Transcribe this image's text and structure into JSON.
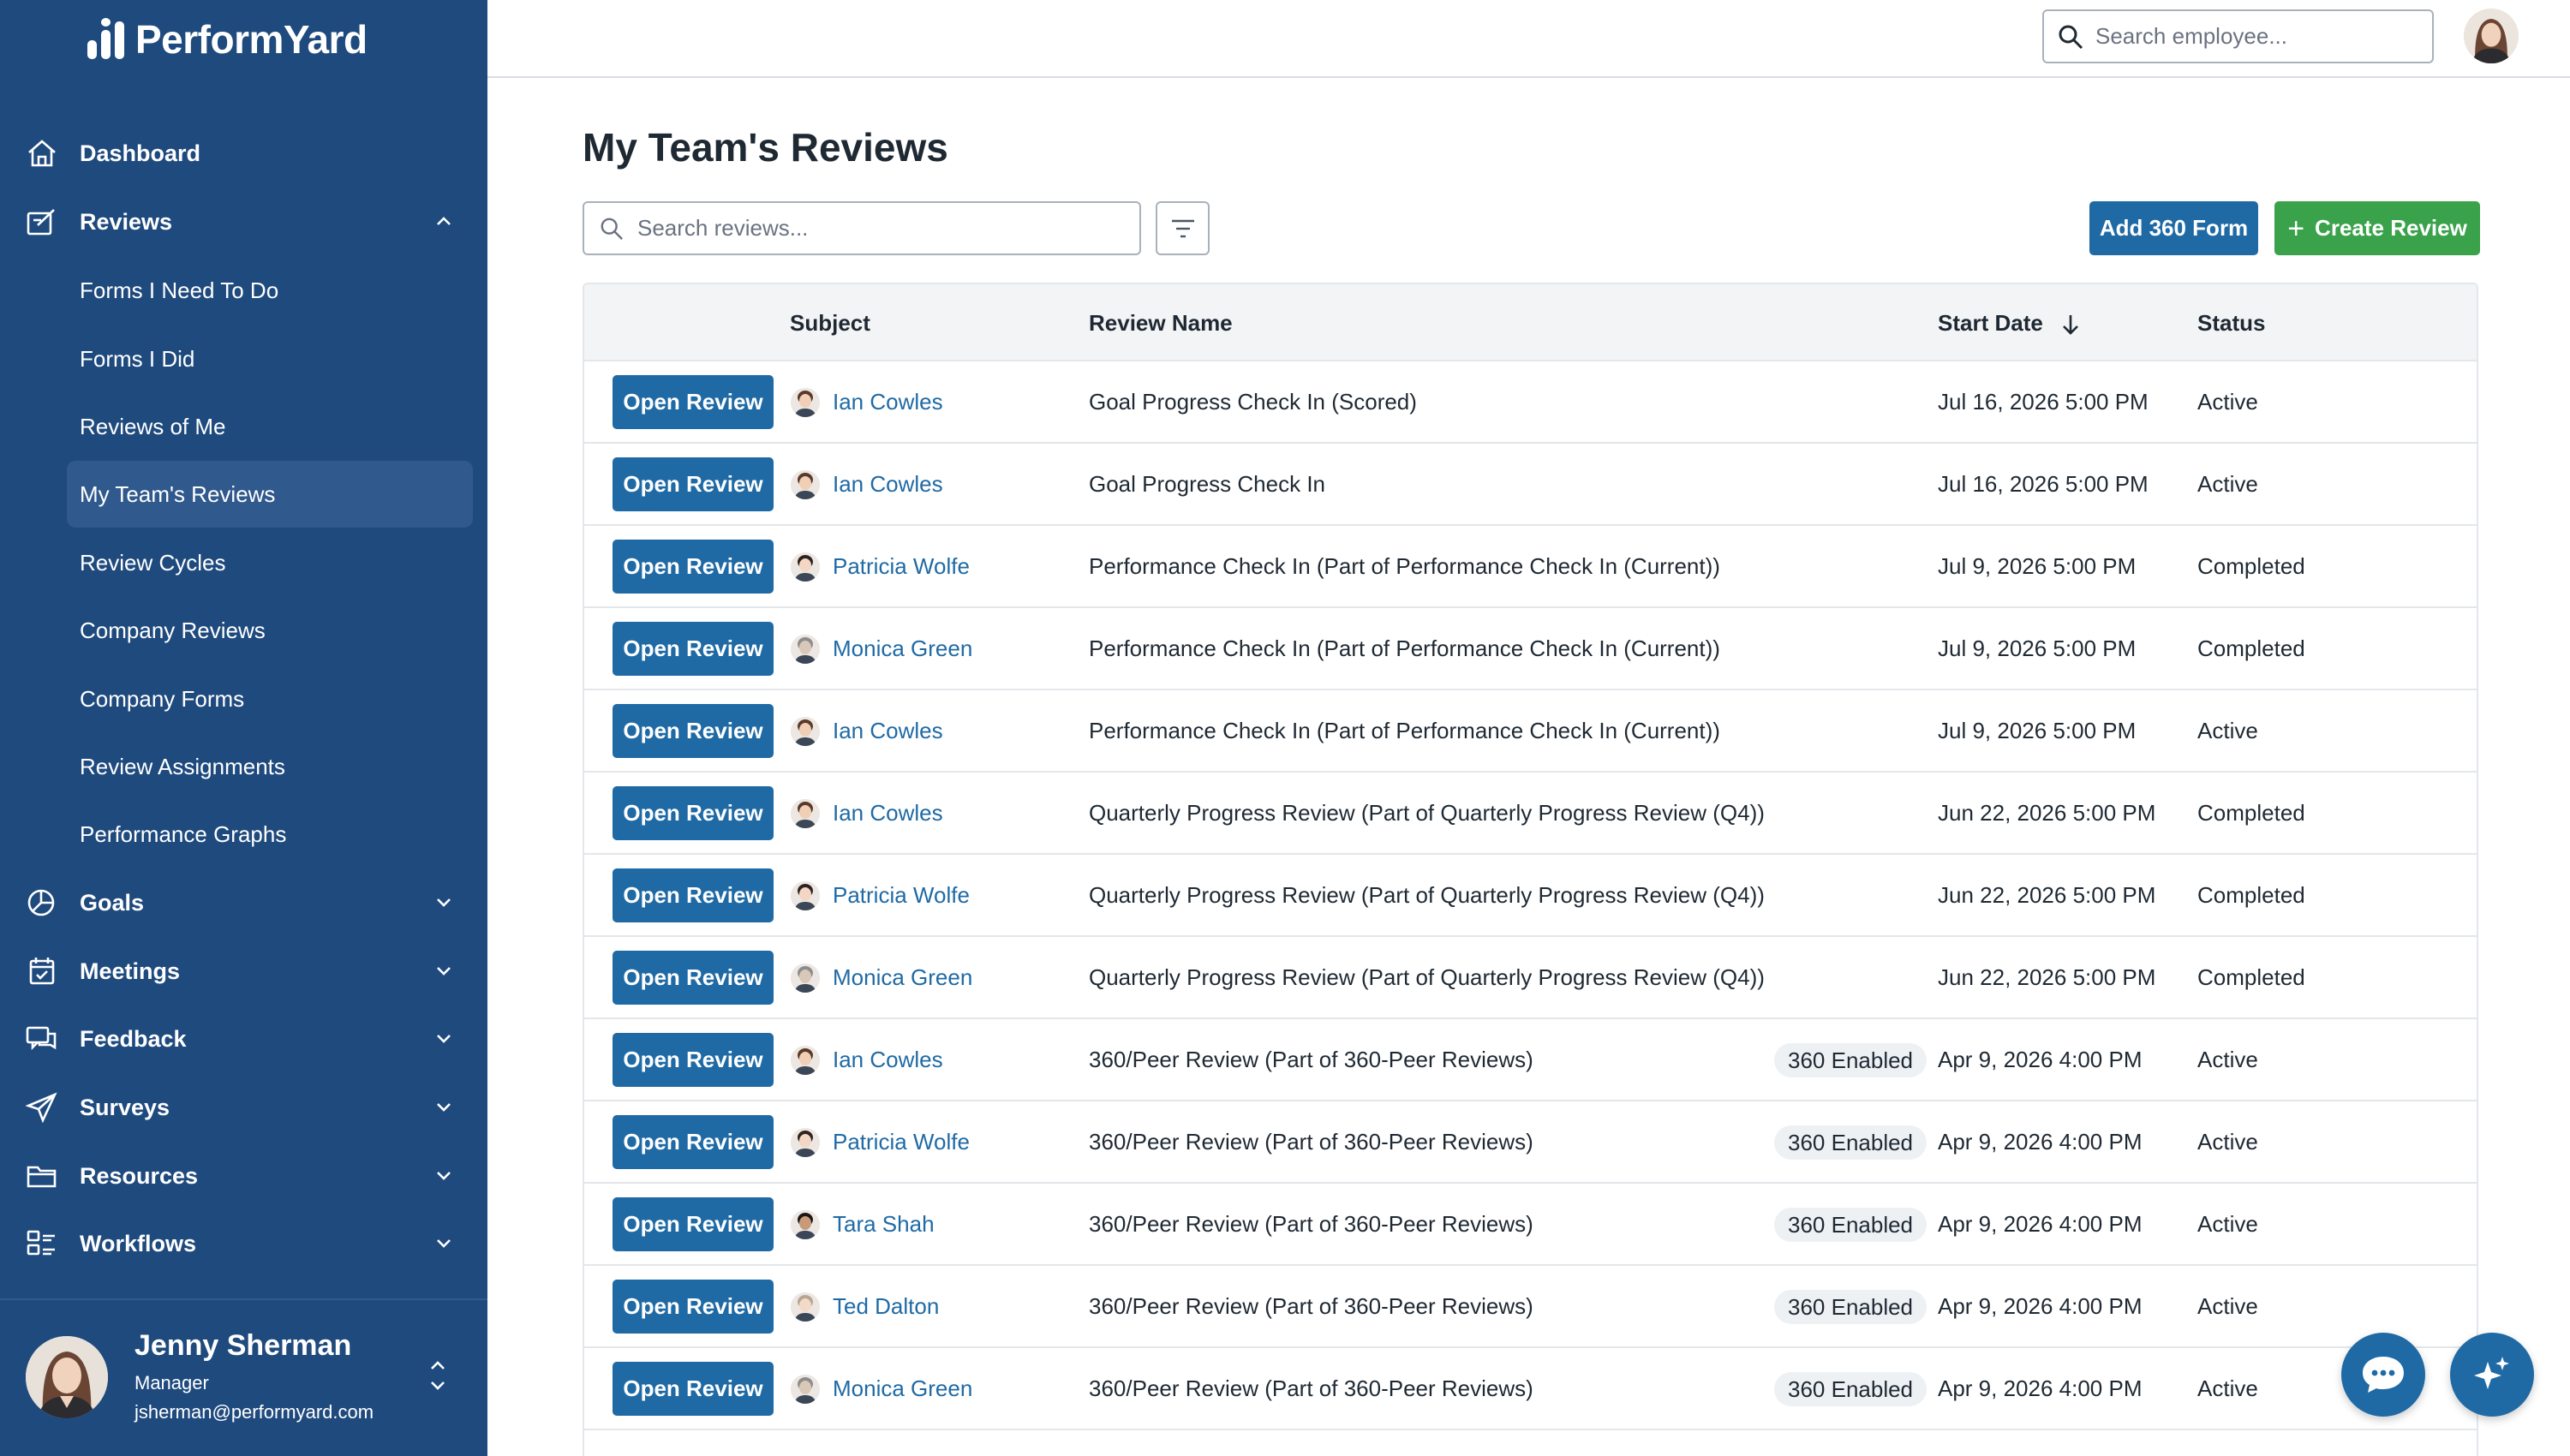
{
  "app": {
    "logo_text": "PerformYard"
  },
  "sidebar": {
    "top_items": [
      {
        "label": "Dashboard",
        "icon": "home-icon"
      },
      {
        "label": "Reviews",
        "icon": "reviews-icon",
        "expanded": true
      }
    ],
    "review_subitems": [
      "Forms I Need To Do",
      "Forms I Did",
      "Reviews of Me",
      "My Team's Reviews",
      "Review Cycles",
      "Company Reviews",
      "Company Forms",
      "Review Assignments",
      "Performance Graphs"
    ],
    "active_subitem": "My Team's Reviews",
    "bottom_items": [
      {
        "label": "Goals",
        "icon": "goals-icon"
      },
      {
        "label": "Meetings",
        "icon": "calendar-icon"
      },
      {
        "label": "Feedback",
        "icon": "feedback-icon"
      },
      {
        "label": "Surveys",
        "icon": "send-icon"
      },
      {
        "label": "Resources",
        "icon": "folder-icon"
      },
      {
        "label": "Workflows",
        "icon": "workflows-icon"
      }
    ],
    "user": {
      "name": "Jenny Sherman",
      "role": "Manager",
      "email": "jsherman@performyard.com"
    }
  },
  "topbar": {
    "search_placeholder": "Search employee..."
  },
  "main": {
    "title": "My Team's Reviews",
    "search_placeholder": "Search reviews...",
    "add_360_label": "Add 360 Form",
    "create_review_label": "Create Review",
    "open_review_label": "Open Review",
    "columns": {
      "subject": "Subject",
      "review_name": "Review Name",
      "start_date": "Start Date",
      "status": "Status"
    },
    "rows": [
      {
        "subject": "Ian Cowles",
        "review_name": "Goal Progress Check In (Scored)",
        "badge": "",
        "start_date": "Jul 16, 2026 5:00 PM",
        "status": "Active"
      },
      {
        "subject": "Ian Cowles",
        "review_name": "Goal Progress Check In",
        "badge": "",
        "start_date": "Jul 16, 2026 5:00 PM",
        "status": "Active"
      },
      {
        "subject": "Patricia Wolfe",
        "review_name": "Performance Check In (Part of Performance Check In (Current))",
        "badge": "",
        "start_date": "Jul 9, 2026 5:00 PM",
        "status": "Completed"
      },
      {
        "subject": "Monica Green",
        "review_name": "Performance Check In (Part of Performance Check In (Current))",
        "badge": "",
        "start_date": "Jul 9, 2026 5:00 PM",
        "status": "Completed"
      },
      {
        "subject": "Ian Cowles",
        "review_name": "Performance Check In (Part of Performance Check In (Current))",
        "badge": "",
        "start_date": "Jul 9, 2026 5:00 PM",
        "status": "Active"
      },
      {
        "subject": "Ian Cowles",
        "review_name": "Quarterly Progress Review (Part of Quarterly Progress Review (Q4))",
        "badge": "",
        "start_date": "Jun 22, 2026 5:00 PM",
        "status": "Completed"
      },
      {
        "subject": "Patricia Wolfe",
        "review_name": "Quarterly Progress Review (Part of Quarterly Progress Review (Q4))",
        "badge": "",
        "start_date": "Jun 22, 2026 5:00 PM",
        "status": "Completed"
      },
      {
        "subject": "Monica Green",
        "review_name": "Quarterly Progress Review (Part of Quarterly Progress Review (Q4))",
        "badge": "",
        "start_date": "Jun 22, 2026 5:00 PM",
        "status": "Completed"
      },
      {
        "subject": "Ian Cowles",
        "review_name": "360/Peer Review (Part of 360-Peer Reviews)",
        "badge": "360 Enabled",
        "start_date": "Apr 9, 2026 4:00 PM",
        "status": "Active"
      },
      {
        "subject": "Patricia Wolfe",
        "review_name": "360/Peer Review (Part of 360-Peer Reviews)",
        "badge": "360 Enabled",
        "start_date": "Apr 9, 2026 4:00 PM",
        "status": "Active"
      },
      {
        "subject": "Tara Shah",
        "review_name": "360/Peer Review (Part of 360-Peer Reviews)",
        "badge": "360 Enabled",
        "start_date": "Apr 9, 2026 4:00 PM",
        "status": "Active"
      },
      {
        "subject": "Ted Dalton",
        "review_name": "360/Peer Review (Part of 360-Peer Reviews)",
        "badge": "360 Enabled",
        "start_date": "Apr 9, 2026 4:00 PM",
        "status": "Active"
      },
      {
        "subject": "Monica Green",
        "review_name": "360/Peer Review (Part of 360-Peer Reviews)",
        "badge": "360 Enabled",
        "start_date": "Apr 9, 2026 4:00 PM",
        "status": "Active"
      }
    ]
  },
  "fabs": [
    {
      "icon": "chat-icon"
    },
    {
      "icon": "ai-sparkle-icon"
    }
  ],
  "colors": {
    "sidebar": "#1f4a7e",
    "primary": "#1f6aa5",
    "success": "#3aa24b",
    "link": "#1f6aa5"
  }
}
